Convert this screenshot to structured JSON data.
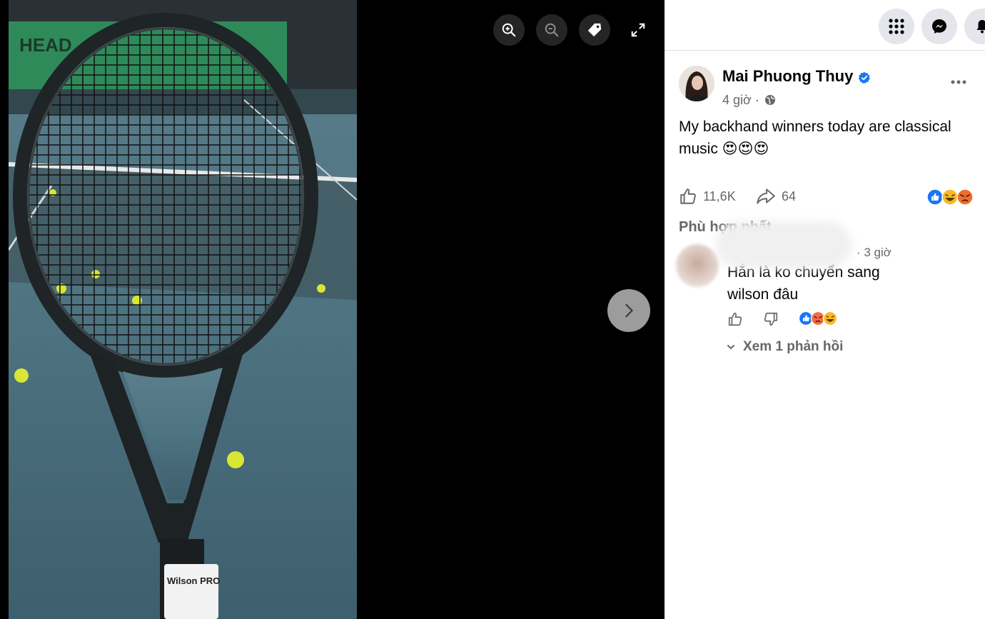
{
  "viewer": {
    "zoom_in": "zoom-in-icon",
    "zoom_out": "zoom-out-icon",
    "tag": "tag-icon",
    "fullscreen": "fullscreen-icon",
    "next": "chevron-right-icon",
    "photo": {
      "net_banner_text": "HEAD",
      "grip_text": "Wilson PRO"
    }
  },
  "topbar": {
    "menu": "grid-menu-icon",
    "messenger": "messenger-icon",
    "notifications": "bell-icon"
  },
  "post": {
    "author": "Mai Phuong Thuy",
    "time": "4 giờ ·",
    "audience": "globe-icon",
    "text": "My backhand winners today are classical music 😍😍😍",
    "likes": "11,6K",
    "shares": "64",
    "reactions": [
      "like",
      "haha",
      "angry"
    ]
  },
  "comments": {
    "sort_label": "Phù hợp nhất",
    "items": [
      {
        "name_tail": "n",
        "time": "· 3 giờ",
        "text": "Hắn là ko chuyển sang wilson đâu",
        "reactions": [
          "like",
          "angry",
          "haha"
        ],
        "view_replies": "Xem 1 phản hồi"
      }
    ]
  },
  "colors": {
    "accent": "#1877f2",
    "secondary_text": "#65676b",
    "viewer_bg": "#000000"
  }
}
